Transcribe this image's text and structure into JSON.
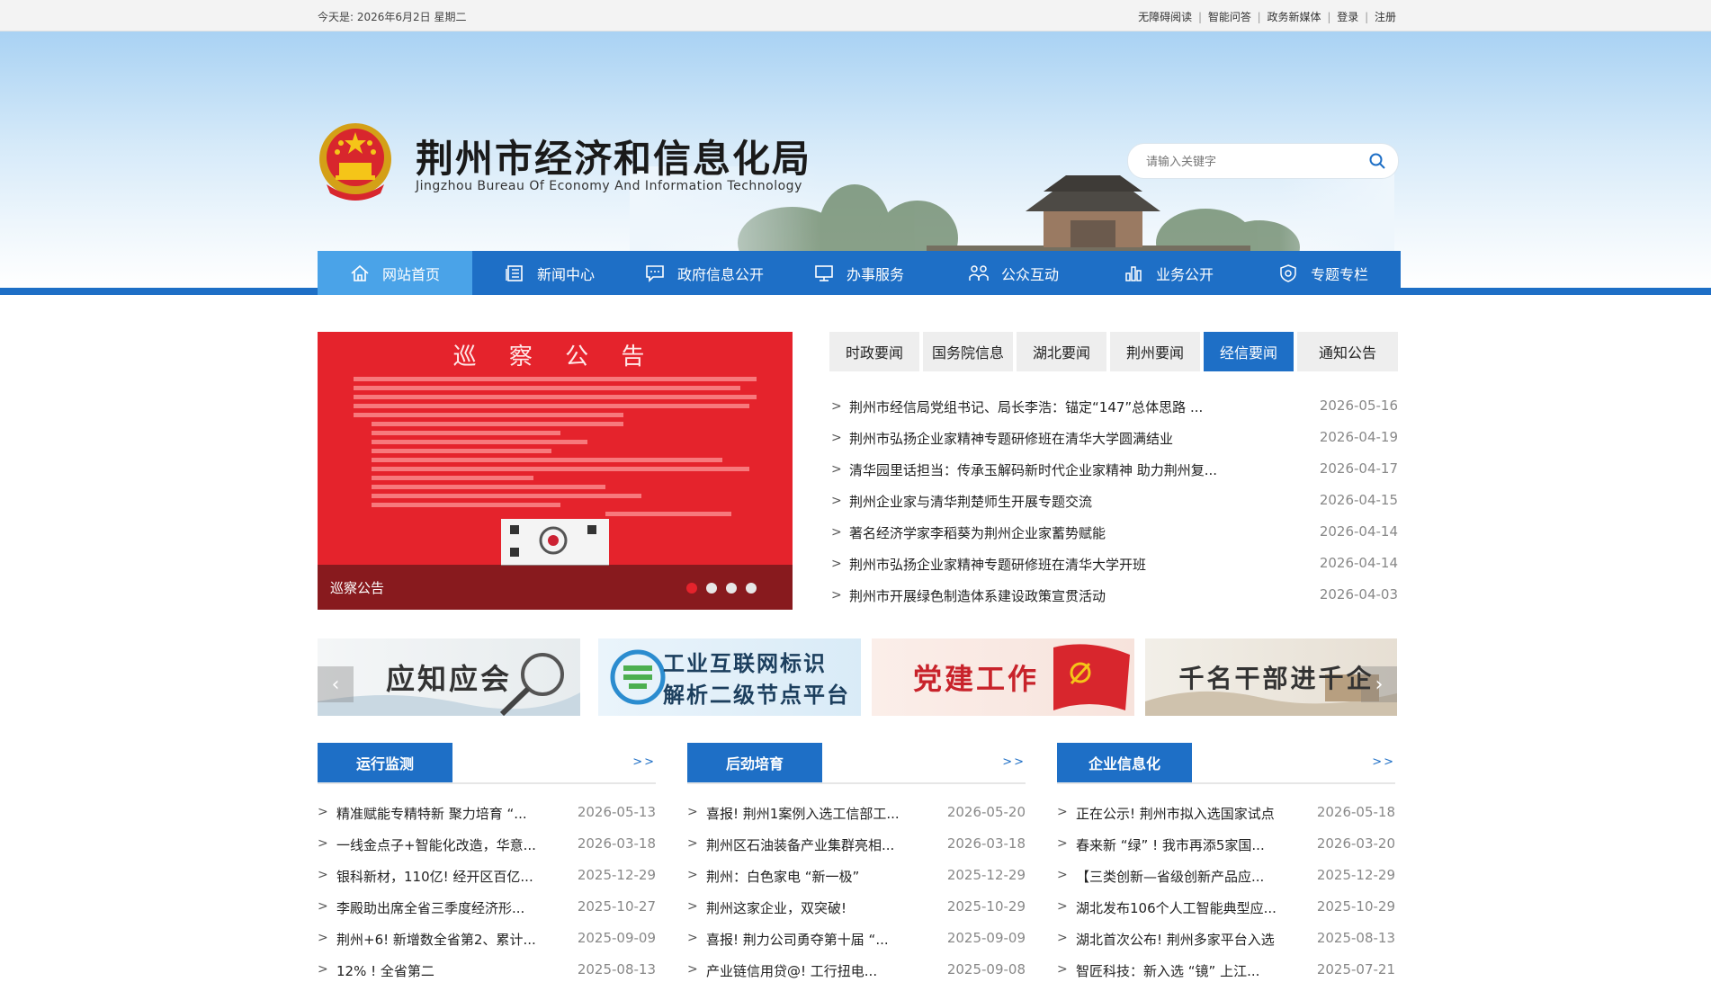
{
  "topbar": {
    "date": "今天是: 2026年6月2日 星期二",
    "links": [
      "无障碍阅读",
      "智能问答",
      "政务新媒体",
      "登录",
      "注册"
    ]
  },
  "header": {
    "title": "荆州市经济和信息化局",
    "subtitle": "Jingzhou Bureau Of Economy And Information Technology",
    "search_placeholder": "请输入关键字"
  },
  "nav": {
    "items": [
      {
        "label": "网站首页",
        "icon": "home-icon"
      },
      {
        "label": "新闻中心",
        "icon": "news-icon"
      },
      {
        "label": "政府信息公开",
        "icon": "chat-icon"
      },
      {
        "label": "办事服务",
        "icon": "monitor-icon"
      },
      {
        "label": "公众互动",
        "icon": "people-icon"
      },
      {
        "label": "业务公开",
        "icon": "bar-chart-icon"
      },
      {
        "label": "专题专栏",
        "icon": "shield-icon"
      }
    ]
  },
  "slider": {
    "caption": "巡察公告",
    "doc_title": "巡 察 公 告",
    "dot_count": 4,
    "active_dot": 1
  },
  "tabs": [
    "时政要闻",
    "国务院信息",
    "湖北要闻",
    "荆州要闻",
    "经信要闻",
    "通知公告"
  ],
  "active_tab": 4,
  "news": [
    {
      "title": "荆州市经信局党组书记、局长李浩：锚定“147”总体思路 ...",
      "date": "2026-05-16"
    },
    {
      "title": "荆州市弘扬企业家精神专题研修班在清华大学圆满结业",
      "date": "2026-04-19"
    },
    {
      "title": "清华园里话担当：传承玉解码新时代企业家精神 助力荆州复...",
      "date": "2026-04-17"
    },
    {
      "title": "荆州企业家与清华荆楚师生开展专题交流",
      "date": "2026-04-15"
    },
    {
      "title": "著名经济学家李稻葵为荆州企业家蓄势赋能",
      "date": "2026-04-14"
    },
    {
      "title": "荆州市弘扬企业家精神专题研修班在清华大学开班",
      "date": "2026-04-14"
    },
    {
      "title": "荆州市开展绿色制造体系建设政策宣贯活动",
      "date": "2026-04-03"
    }
  ],
  "cards": [
    {
      "line1": "应知应会",
      "line2": ""
    },
    {
      "line1": "工业互联网标识",
      "line2": "解析二级节点平台"
    },
    {
      "line1": "党建工作",
      "line2": ""
    },
    {
      "line1": "千名干部进千企",
      "line2": ""
    }
  ],
  "carousel_arrows": {
    "prev": "‹",
    "next": "›"
  },
  "columns": [
    {
      "title": "运行监测",
      "more": ">>",
      "rows": [
        {
          "title": "精准赋能专精特新 聚力培育 “...",
          "date": "2026-05-13"
        },
        {
          "title": "一线金点子+智能化改造，华意...",
          "date": "2026-03-18"
        },
        {
          "title": "银科新材，110亿! 经开区百亿...",
          "date": "2025-12-29"
        },
        {
          "title": "李殿助出席全省三季度经济形...",
          "date": "2025-10-27"
        },
        {
          "title": "荆州+6! 新增数全省第2、累计...",
          "date": "2025-09-09"
        },
        {
          "title": "12% ! 全省第二",
          "date": "2025-08-13"
        }
      ]
    },
    {
      "title": "后劲培育",
      "more": ">>",
      "rows": [
        {
          "title": "喜报! 荆州1案例入选工信部工...",
          "date": "2026-05-20"
        },
        {
          "title": "荆州区石油装备产业集群亮相...",
          "date": "2026-03-18"
        },
        {
          "title": "荆州：白色家电 “新一极”",
          "date": "2025-12-29"
        },
        {
          "title": "荆州这家企业，双突破!",
          "date": "2025-10-29"
        },
        {
          "title": "喜报! 荆力公司勇夺第十届 “...",
          "date": "2025-09-09"
        },
        {
          "title": "产业链信用贷@! 工行扭电...",
          "date": "2025-09-08"
        }
      ]
    },
    {
      "title": "企业信息化",
      "more": ">>",
      "rows": [
        {
          "title": "正在公示! 荆州市拟入选国家试点",
          "date": "2026-05-18"
        },
        {
          "title": "春来新 “绿” ! 我市再添5家国...",
          "date": "2026-03-20"
        },
        {
          "title": "【三类创新—省级创新产品应...",
          "date": "2025-12-29"
        },
        {
          "title": "湖北发布106个人工智能典型应...",
          "date": "2025-10-29"
        },
        {
          "title": "湖北首次公布! 荆州多家平台入选",
          "date": "2025-08-13"
        },
        {
          "title": "智匠科技：新入选 “镜” 上江...",
          "date": "2025-07-21"
        }
      ]
    }
  ]
}
